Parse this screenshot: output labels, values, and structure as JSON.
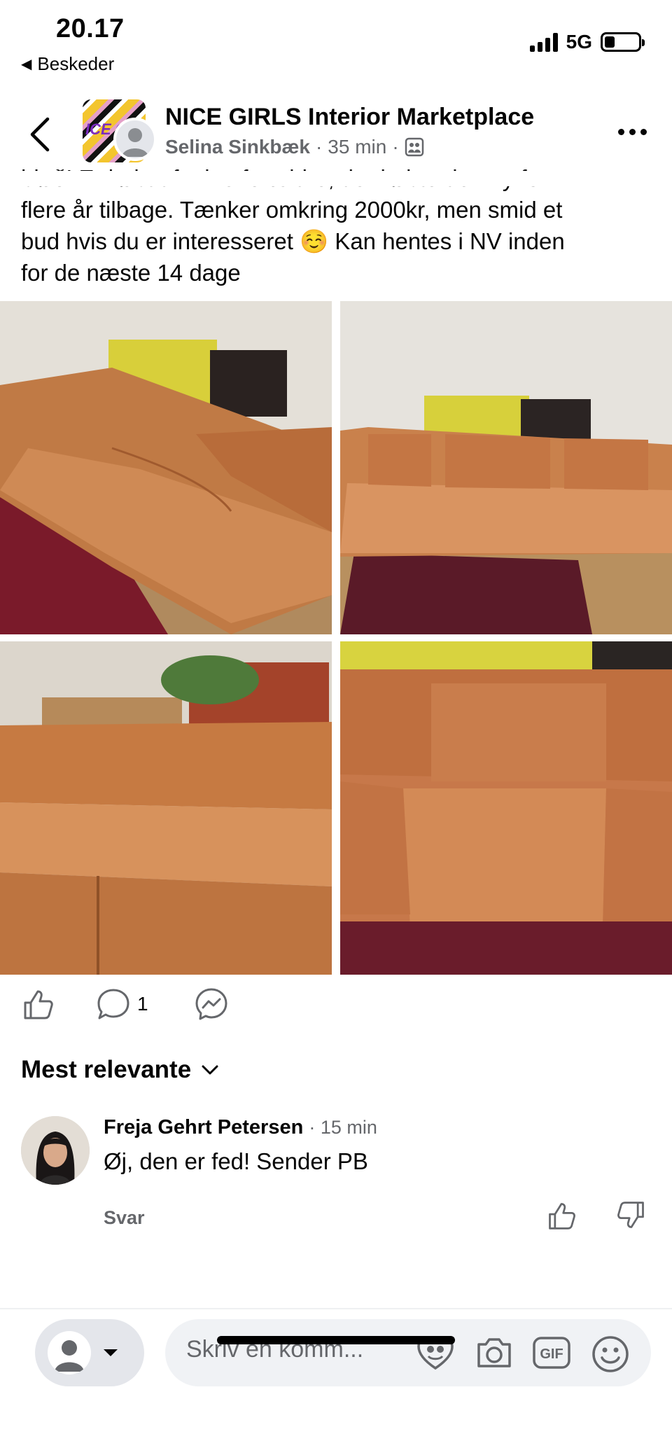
{
  "status_bar": {
    "time": "20.17",
    "back_app": "Beskeder",
    "network": "5G"
  },
  "header": {
    "group_name": "NICE GIRLS Interior Marketplace",
    "group_logo_text": "ICE G",
    "author": "Selina Sinkbæk",
    "time": "35 min",
    "separator": "·"
  },
  "post": {
    "text_partial_top": "bløð! Er købt af mine forældre, der købte den ny for",
    "text_lines": [
      "flere år tilbage. Tænker omkring 2000kr, men smid et",
      "bud hvis du er interesseret ☺️ Kan hentes i NV inden",
      "for de næste 14 dage"
    ]
  },
  "actions": {
    "comment_count": "1"
  },
  "sort": {
    "label": "Mest relevante"
  },
  "comment": {
    "author": "Freja Gehrt Petersen",
    "time": "· 15 min",
    "text": "Øj, den er fed! Sender PB",
    "reply_label": "Svar"
  },
  "composer": {
    "placeholder": "Skriv en komm...",
    "gif_label": "GIF"
  },
  "icons": [
    "chevron-left-icon",
    "more-icon",
    "like-icon",
    "comment-icon",
    "messenger-icon",
    "chevron-down-icon",
    "thumb-up-icon",
    "thumb-down-icon",
    "avatar-stickers-icon",
    "camera-icon",
    "gif-icon",
    "emoji-icon"
  ]
}
